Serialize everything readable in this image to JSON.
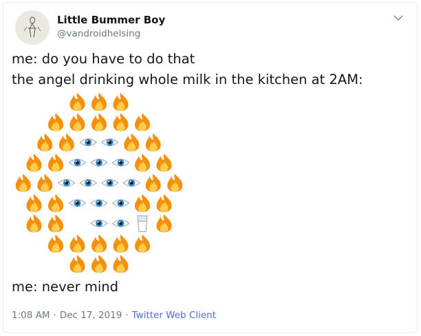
{
  "tweet": {
    "display_name": "Little Bummer Boy",
    "handle": "@vandroidhelsing",
    "line1": "me: do you have to do that",
    "line2": "the angel drinking whole milk in the kitchen at 2AM:",
    "line3": "me: never mind",
    "time": "1:08 AM",
    "separator": "·",
    "date": "Dec 17, 2019",
    "client": "Twitter Web Client"
  },
  "art": {
    "rows": [
      [
        "fire",
        "fire",
        "fire"
      ],
      [
        "fire",
        "fire",
        "fire",
        "fire",
        "fire"
      ],
      [
        "fire",
        "fire",
        "eye",
        "eye",
        "fire",
        "fire"
      ],
      [
        "fire",
        "fire",
        "eye",
        "eye",
        "eye",
        "fire",
        "fire"
      ],
      [
        "fire",
        "fire",
        "eye",
        "eye",
        "eye",
        "eye",
        "fire",
        "fire"
      ],
      [
        "fire",
        "fire",
        "eye",
        "eye",
        "eye",
        "fire",
        "fire"
      ],
      [
        "fire",
        "fire",
        "blank",
        "eye",
        "eye",
        "milk",
        "fire"
      ],
      [
        "fire",
        "fire",
        "fire",
        "fire",
        "fire"
      ],
      [
        "fire",
        "fire",
        "fire"
      ]
    ]
  }
}
